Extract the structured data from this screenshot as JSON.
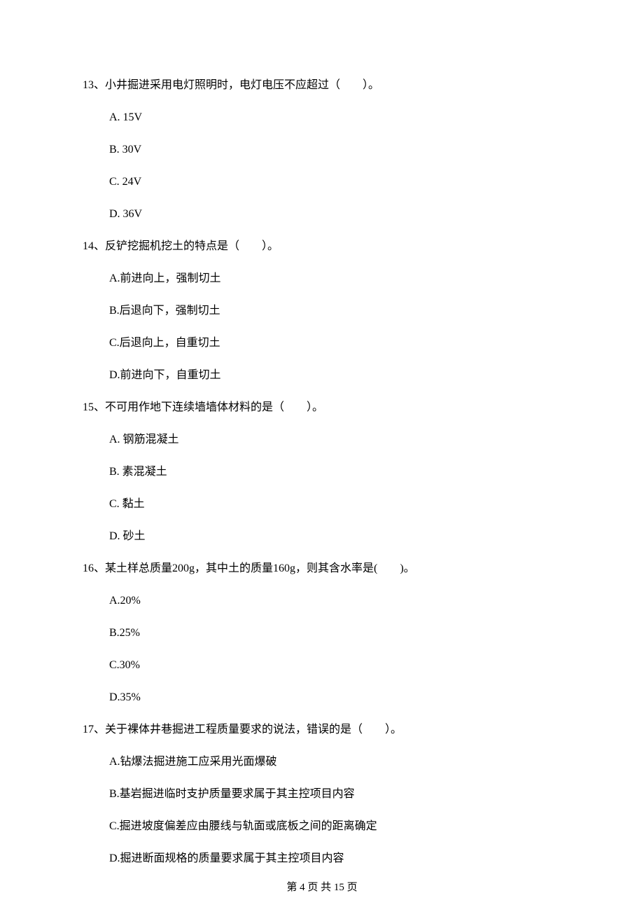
{
  "questions": [
    {
      "number": "13、",
      "stem": "小井掘进采用电灯照明时，电灯电压不应超过（　　）。",
      "options": [
        "A.  15V",
        "B.  30V",
        "C.  24V",
        "D.  36V"
      ]
    },
    {
      "number": "14、",
      "stem": "反铲挖掘机挖土的特点是（　　）。",
      "options": [
        "A.前进向上，强制切土",
        "B.后退向下，强制切土",
        "C.后退向上，自重切土",
        "D.前进向下，自重切土"
      ]
    },
    {
      "number": "15、",
      "stem": "不可用作地下连续墙墙体材料的是（　　）。",
      "options": [
        "A.  钢筋混凝土",
        "B.  素混凝土",
        "C.  黏土",
        "D.  砂土"
      ]
    },
    {
      "number": "16、",
      "stem": "某土样总质量200g，其中土的质量160g，则其含水率是(　　)。",
      "options": [
        "A.20%",
        "B.25%",
        "C.30%",
        "D.35%"
      ]
    },
    {
      "number": "17、",
      "stem": "关于裸体井巷掘进工程质量要求的说法，错误的是（　　）。",
      "options": [
        "A.钻爆法掘进施工应采用光面爆破",
        "B.基岩掘进临时支护质量要求属于其主控项目内容",
        "C.掘进坡度偏差应由腰线与轨面或底板之间的距离确定",
        "D.掘进断面规格的质量要求属于其主控项目内容"
      ]
    }
  ],
  "footer": "第 4 页 共 15 页"
}
